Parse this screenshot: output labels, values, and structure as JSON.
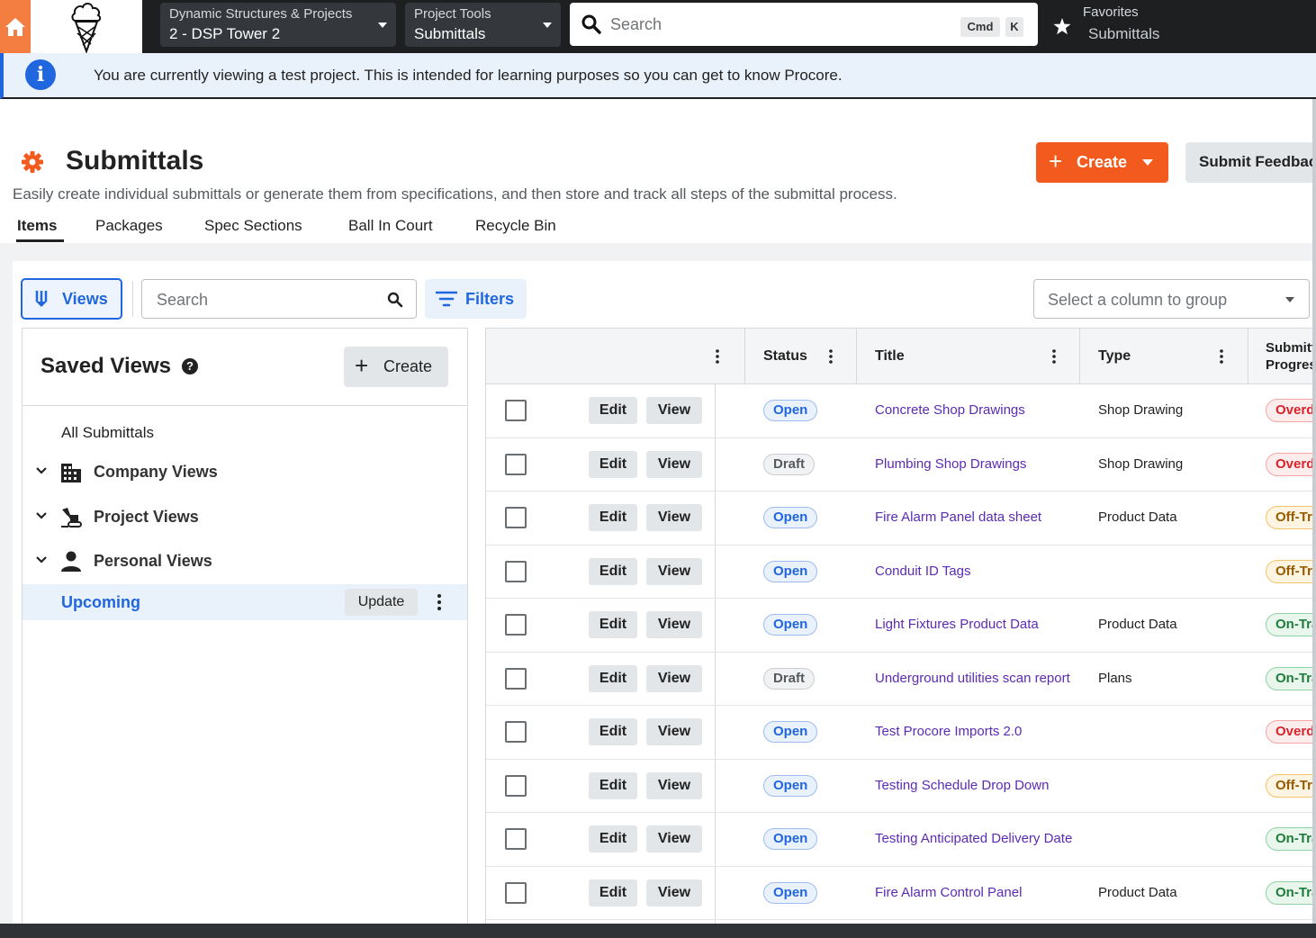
{
  "topbar": {
    "project_selector": {
      "company": "Dynamic Structures & Projects",
      "project": "2 - DSP Tower 2"
    },
    "tool_selector": {
      "label": "Project Tools",
      "tool": "Submittals"
    },
    "search": {
      "placeholder": "Search",
      "shortcut_cmd": "Cmd",
      "shortcut_key": "K"
    },
    "favorites": {
      "label": "Favorites",
      "item": "Submittals"
    }
  },
  "banner": {
    "text": "You are currently viewing a test project. This is intended for learning purposes so you can get to know Procore."
  },
  "header": {
    "title": "Submittals",
    "subtitle": "Easily create individual submittals or generate them from specifications, and then store and track all steps of the submittal process.",
    "create_label": "Create",
    "feedback_label": "Submit Feedback"
  },
  "tabs": [
    {
      "label": "Items",
      "active": true
    },
    {
      "label": "Packages"
    },
    {
      "label": "Spec Sections"
    },
    {
      "label": "Ball In Court"
    },
    {
      "label": "Recycle Bin"
    }
  ],
  "toolbar": {
    "views_label": "Views",
    "search_placeholder": "Search",
    "filters_label": "Filters",
    "group_placeholder": "Select a column to group"
  },
  "saved_views": {
    "title": "Saved Views",
    "create_label": "Create",
    "all_label": "All Submittals",
    "groups": [
      {
        "label": "Company Views",
        "icon": "building-icon"
      },
      {
        "label": "Project Views",
        "icon": "excavator-icon"
      },
      {
        "label": "Personal Views",
        "icon": "person-icon"
      }
    ],
    "selected": {
      "label": "Upcoming",
      "update_label": "Update"
    }
  },
  "table": {
    "columns": {
      "status": "Status",
      "title": "Title",
      "type": "Type",
      "progress": "Submittal Progress"
    },
    "edit_label": "Edit",
    "view_label": "View",
    "rows": [
      {
        "status": "Open",
        "title": "Concrete Shop Drawings",
        "type": "Shop Drawing",
        "progress": "Overdue"
      },
      {
        "status": "Draft",
        "title": "Plumbing Shop Drawings",
        "type": "Shop Drawing",
        "progress": "Overdue"
      },
      {
        "status": "Open",
        "title": "Fire Alarm Panel data sheet",
        "type": "Product Data",
        "progress": "Off-Track"
      },
      {
        "status": "Open",
        "title": "Conduit ID Tags",
        "type": "",
        "progress": "Off-Track"
      },
      {
        "status": "Open",
        "title": "Light Fixtures Product Data",
        "type": "Product Data",
        "progress": "On-Track"
      },
      {
        "status": "Draft",
        "title": "Underground utilities scan report",
        "type": "Plans",
        "progress": "On-Track"
      },
      {
        "status": "Open",
        "title": "Test Procore Imports 2.0",
        "type": "",
        "progress": "Overdue"
      },
      {
        "status": "Open",
        "title": "Testing Schedule Drop Down",
        "type": "",
        "progress": "Off-Track"
      },
      {
        "status": "Open",
        "title": "Testing Anticipated Delivery Date",
        "type": "",
        "progress": "On-Track"
      },
      {
        "status": "Open",
        "title": "Fire Alarm Control Panel",
        "type": "Product Data",
        "progress": "On-Track"
      }
    ]
  },
  "colors": {
    "brand_orange": "#f35a1e",
    "link_blue": "#2066df",
    "title_purple": "#5b2bb5",
    "overdue_red": "#d9242a",
    "offtrack_amber": "#9a5b00",
    "ontrack_green": "#1e7d3b"
  }
}
